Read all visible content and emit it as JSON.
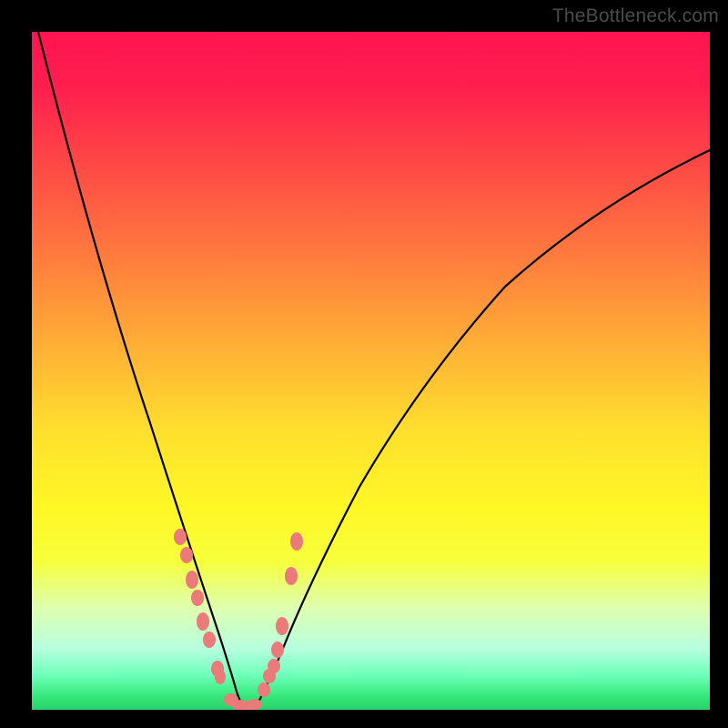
{
  "watermark": "TheBottleneck.com",
  "chart_data": {
    "type": "line",
    "title": "",
    "xlabel": "",
    "ylabel": "",
    "xlim": [
      0,
      100
    ],
    "ylim": [
      0,
      100
    ],
    "grid": false,
    "legend": {
      "show": false
    },
    "note": "Bottleneck V-curve: two branches meeting near bottom; salmon markers along lower segments; green band at bottom indicates optimal (low) bottleneck region.",
    "series": [
      {
        "name": "left-branch",
        "x": [
          1,
          5,
          9,
          13,
          17,
          20,
          23,
          25,
          27,
          28.5,
          30
        ],
        "y": [
          99,
          84,
          70,
          56,
          42,
          30,
          19,
          11,
          5,
          1.5,
          0
        ],
        "color": "#000000"
      },
      {
        "name": "right-branch",
        "x": [
          32,
          34,
          37,
          41,
          46,
          53,
          62,
          73,
          86,
          100
        ],
        "y": [
          0,
          2,
          6,
          12,
          20,
          30,
          42,
          55,
          68,
          80
        ],
        "color": "#000000"
      }
    ],
    "points": {
      "name": "data-points",
      "color": "#eb7a7a",
      "x": [
        21.5,
        22.5,
        23.3,
        24.0,
        24.9,
        25.8,
        27.0,
        27.4,
        29.0,
        30.2,
        31.0,
        32.3,
        33.8,
        34.6,
        35.4,
        35.9,
        36.5,
        37.8,
        38.6
      ],
      "y": [
        25.0,
        22.0,
        18.5,
        16.0,
        12.5,
        10.0,
        5.5,
        4.5,
        1.0,
        0.5,
        0.5,
        1.0,
        3.0,
        5.0,
        6.5,
        9.0,
        12.5,
        20.0,
        25.0
      ]
    }
  }
}
